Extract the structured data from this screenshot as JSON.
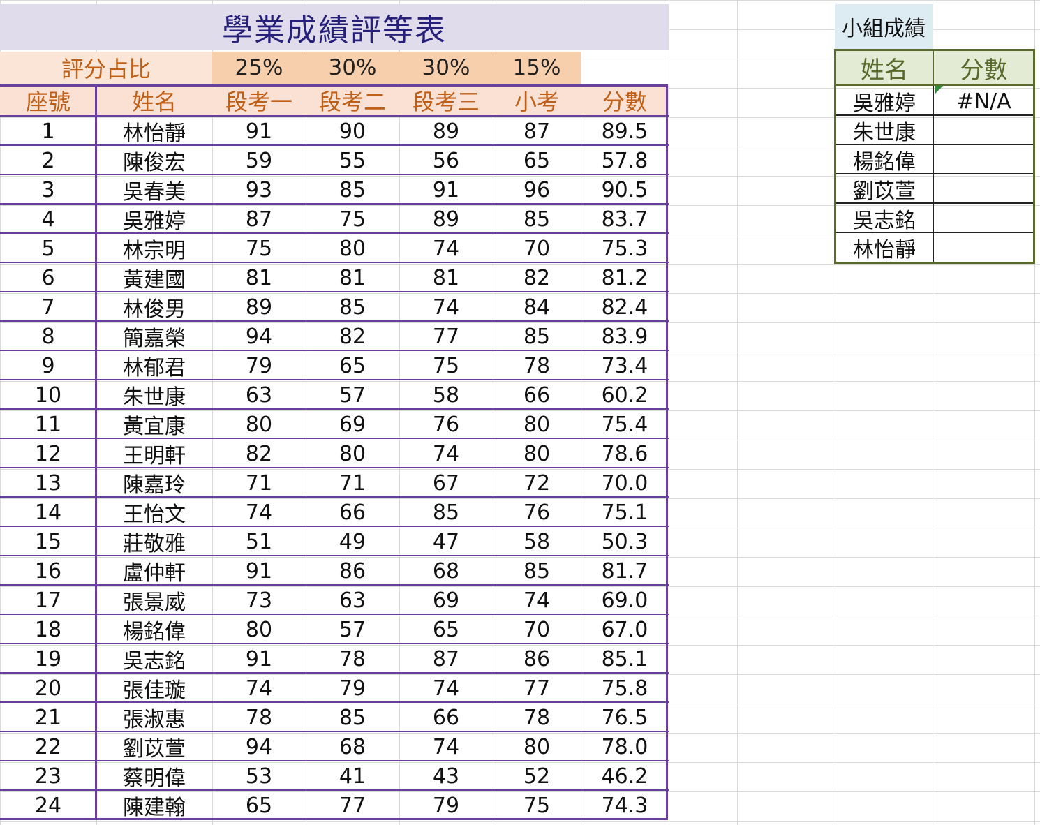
{
  "sheet": {
    "title": "學業成績評等表",
    "weight_label": "評分占比",
    "weights": [
      "25%",
      "30%",
      "30%",
      "15%"
    ],
    "headers": [
      "座號",
      "姓名",
      "段考一",
      "段考二",
      "段考三",
      "小考",
      "分數"
    ],
    "rows": [
      [
        "1",
        "林怡靜",
        "91",
        "90",
        "89",
        "87",
        "89.5"
      ],
      [
        "2",
        "陳俊宏",
        "59",
        "55",
        "56",
        "65",
        "57.8"
      ],
      [
        "3",
        "吳春美",
        "93",
        "85",
        "91",
        "96",
        "90.5"
      ],
      [
        "4",
        "吳雅婷",
        "87",
        "75",
        "89",
        "85",
        "83.7"
      ],
      [
        "5",
        "林宗明",
        "75",
        "80",
        "74",
        "70",
        "75.3"
      ],
      [
        "6",
        "黃建國",
        "81",
        "81",
        "81",
        "82",
        "81.2"
      ],
      [
        "7",
        "林俊男",
        "89",
        "85",
        "74",
        "84",
        "82.4"
      ],
      [
        "8",
        "簡嘉榮",
        "94",
        "82",
        "77",
        "85",
        "83.9"
      ],
      [
        "9",
        "林郁君",
        "79",
        "65",
        "75",
        "78",
        "73.4"
      ],
      [
        "10",
        "朱世康",
        "63",
        "57",
        "58",
        "66",
        "60.2"
      ],
      [
        "11",
        "黃宜康",
        "80",
        "69",
        "76",
        "80",
        "75.4"
      ],
      [
        "12",
        "王明軒",
        "82",
        "80",
        "74",
        "80",
        "78.6"
      ],
      [
        "13",
        "陳嘉玲",
        "71",
        "71",
        "67",
        "72",
        "70.0"
      ],
      [
        "14",
        "王怡文",
        "74",
        "66",
        "85",
        "76",
        "75.1"
      ],
      [
        "15",
        "莊敬雅",
        "51",
        "49",
        "47",
        "58",
        "50.3"
      ],
      [
        "16",
        "盧仲軒",
        "91",
        "86",
        "68",
        "85",
        "81.7"
      ],
      [
        "17",
        "張景威",
        "73",
        "63",
        "69",
        "74",
        "69.0"
      ],
      [
        "18",
        "楊銘偉",
        "80",
        "57",
        "65",
        "70",
        "67.0"
      ],
      [
        "19",
        "吳志銘",
        "91",
        "78",
        "87",
        "86",
        "85.1"
      ],
      [
        "20",
        "張佳璇",
        "74",
        "79",
        "74",
        "77",
        "75.8"
      ],
      [
        "21",
        "張淑惠",
        "78",
        "85",
        "66",
        "78",
        "76.5"
      ],
      [
        "22",
        "劉苡萱",
        "94",
        "68",
        "74",
        "80",
        "78.0"
      ],
      [
        "23",
        "蔡明偉",
        "53",
        "41",
        "43",
        "52",
        "46.2"
      ],
      [
        "24",
        "陳建翰",
        "65",
        "77",
        "79",
        "75",
        "74.3"
      ]
    ]
  },
  "group": {
    "title": "小組成績",
    "headers": [
      "姓名",
      "分數"
    ],
    "rows": [
      [
        "吳雅婷",
        "#N/A"
      ],
      [
        "朱世康",
        ""
      ],
      [
        "楊銘偉",
        ""
      ],
      [
        "劉苡萱",
        ""
      ],
      [
        "吳志銘",
        ""
      ],
      [
        "林怡靜",
        ""
      ]
    ]
  },
  "colors": {
    "title_bg": "#e0dcec",
    "title_text": "#26207a",
    "weight_label_bg": "#fbe5d6",
    "weight_values_bg": "#f8cfad",
    "header_bg": "#fbe0d4",
    "header_text": "#c06018",
    "table_border": "#6a3fa0",
    "group_title_bg": "#ddebf2",
    "group_header_bg": "#e3ebd4",
    "group_border": "#5a6a2c",
    "error_indicator": "#2e8b3a"
  },
  "icons": {
    "error_indicator": "error-indicator-triangle-icon"
  }
}
